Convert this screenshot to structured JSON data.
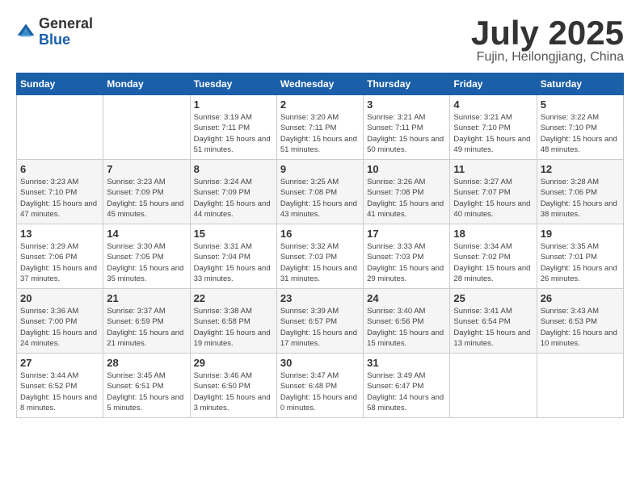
{
  "header": {
    "logo_general": "General",
    "logo_blue": "Blue",
    "title": "July 2025",
    "subtitle": "Fujin, Heilongjiang, China"
  },
  "weekdays": [
    "Sunday",
    "Monday",
    "Tuesday",
    "Wednesday",
    "Thursday",
    "Friday",
    "Saturday"
  ],
  "weeks": [
    [
      {
        "day": "",
        "sunrise": "",
        "sunset": "",
        "daylight": ""
      },
      {
        "day": "",
        "sunrise": "",
        "sunset": "",
        "daylight": ""
      },
      {
        "day": "1",
        "sunrise": "Sunrise: 3:19 AM",
        "sunset": "Sunset: 7:11 PM",
        "daylight": "Daylight: 15 hours and 51 minutes."
      },
      {
        "day": "2",
        "sunrise": "Sunrise: 3:20 AM",
        "sunset": "Sunset: 7:11 PM",
        "daylight": "Daylight: 15 hours and 51 minutes."
      },
      {
        "day": "3",
        "sunrise": "Sunrise: 3:21 AM",
        "sunset": "Sunset: 7:11 PM",
        "daylight": "Daylight: 15 hours and 50 minutes."
      },
      {
        "day": "4",
        "sunrise": "Sunrise: 3:21 AM",
        "sunset": "Sunset: 7:10 PM",
        "daylight": "Daylight: 15 hours and 49 minutes."
      },
      {
        "day": "5",
        "sunrise": "Sunrise: 3:22 AM",
        "sunset": "Sunset: 7:10 PM",
        "daylight": "Daylight: 15 hours and 48 minutes."
      }
    ],
    [
      {
        "day": "6",
        "sunrise": "Sunrise: 3:23 AM",
        "sunset": "Sunset: 7:10 PM",
        "daylight": "Daylight: 15 hours and 47 minutes."
      },
      {
        "day": "7",
        "sunrise": "Sunrise: 3:23 AM",
        "sunset": "Sunset: 7:09 PM",
        "daylight": "Daylight: 15 hours and 45 minutes."
      },
      {
        "day": "8",
        "sunrise": "Sunrise: 3:24 AM",
        "sunset": "Sunset: 7:09 PM",
        "daylight": "Daylight: 15 hours and 44 minutes."
      },
      {
        "day": "9",
        "sunrise": "Sunrise: 3:25 AM",
        "sunset": "Sunset: 7:08 PM",
        "daylight": "Daylight: 15 hours and 43 minutes."
      },
      {
        "day": "10",
        "sunrise": "Sunrise: 3:26 AM",
        "sunset": "Sunset: 7:08 PM",
        "daylight": "Daylight: 15 hours and 41 minutes."
      },
      {
        "day": "11",
        "sunrise": "Sunrise: 3:27 AM",
        "sunset": "Sunset: 7:07 PM",
        "daylight": "Daylight: 15 hours and 40 minutes."
      },
      {
        "day": "12",
        "sunrise": "Sunrise: 3:28 AM",
        "sunset": "Sunset: 7:06 PM",
        "daylight": "Daylight: 15 hours and 38 minutes."
      }
    ],
    [
      {
        "day": "13",
        "sunrise": "Sunrise: 3:29 AM",
        "sunset": "Sunset: 7:06 PM",
        "daylight": "Daylight: 15 hours and 37 minutes."
      },
      {
        "day": "14",
        "sunrise": "Sunrise: 3:30 AM",
        "sunset": "Sunset: 7:05 PM",
        "daylight": "Daylight: 15 hours and 35 minutes."
      },
      {
        "day": "15",
        "sunrise": "Sunrise: 3:31 AM",
        "sunset": "Sunset: 7:04 PM",
        "daylight": "Daylight: 15 hours and 33 minutes."
      },
      {
        "day": "16",
        "sunrise": "Sunrise: 3:32 AM",
        "sunset": "Sunset: 7:03 PM",
        "daylight": "Daylight: 15 hours and 31 minutes."
      },
      {
        "day": "17",
        "sunrise": "Sunrise: 3:33 AM",
        "sunset": "Sunset: 7:03 PM",
        "daylight": "Daylight: 15 hours and 29 minutes."
      },
      {
        "day": "18",
        "sunrise": "Sunrise: 3:34 AM",
        "sunset": "Sunset: 7:02 PM",
        "daylight": "Daylight: 15 hours and 28 minutes."
      },
      {
        "day": "19",
        "sunrise": "Sunrise: 3:35 AM",
        "sunset": "Sunset: 7:01 PM",
        "daylight": "Daylight: 15 hours and 26 minutes."
      }
    ],
    [
      {
        "day": "20",
        "sunrise": "Sunrise: 3:36 AM",
        "sunset": "Sunset: 7:00 PM",
        "daylight": "Daylight: 15 hours and 24 minutes."
      },
      {
        "day": "21",
        "sunrise": "Sunrise: 3:37 AM",
        "sunset": "Sunset: 6:59 PM",
        "daylight": "Daylight: 15 hours and 21 minutes."
      },
      {
        "day": "22",
        "sunrise": "Sunrise: 3:38 AM",
        "sunset": "Sunset: 6:58 PM",
        "daylight": "Daylight: 15 hours and 19 minutes."
      },
      {
        "day": "23",
        "sunrise": "Sunrise: 3:39 AM",
        "sunset": "Sunset: 6:57 PM",
        "daylight": "Daylight: 15 hours and 17 minutes."
      },
      {
        "day": "24",
        "sunrise": "Sunrise: 3:40 AM",
        "sunset": "Sunset: 6:56 PM",
        "daylight": "Daylight: 15 hours and 15 minutes."
      },
      {
        "day": "25",
        "sunrise": "Sunrise: 3:41 AM",
        "sunset": "Sunset: 6:54 PM",
        "daylight": "Daylight: 15 hours and 13 minutes."
      },
      {
        "day": "26",
        "sunrise": "Sunrise: 3:43 AM",
        "sunset": "Sunset: 6:53 PM",
        "daylight": "Daylight: 15 hours and 10 minutes."
      }
    ],
    [
      {
        "day": "27",
        "sunrise": "Sunrise: 3:44 AM",
        "sunset": "Sunset: 6:52 PM",
        "daylight": "Daylight: 15 hours and 8 minutes."
      },
      {
        "day": "28",
        "sunrise": "Sunrise: 3:45 AM",
        "sunset": "Sunset: 6:51 PM",
        "daylight": "Daylight: 15 hours and 5 minutes."
      },
      {
        "day": "29",
        "sunrise": "Sunrise: 3:46 AM",
        "sunset": "Sunset: 6:50 PM",
        "daylight": "Daylight: 15 hours and 3 minutes."
      },
      {
        "day": "30",
        "sunrise": "Sunrise: 3:47 AM",
        "sunset": "Sunset: 6:48 PM",
        "daylight": "Daylight: 15 hours and 0 minutes."
      },
      {
        "day": "31",
        "sunrise": "Sunrise: 3:49 AM",
        "sunset": "Sunset: 6:47 PM",
        "daylight": "Daylight: 14 hours and 58 minutes."
      },
      {
        "day": "",
        "sunrise": "",
        "sunset": "",
        "daylight": ""
      },
      {
        "day": "",
        "sunrise": "",
        "sunset": "",
        "daylight": ""
      }
    ]
  ]
}
